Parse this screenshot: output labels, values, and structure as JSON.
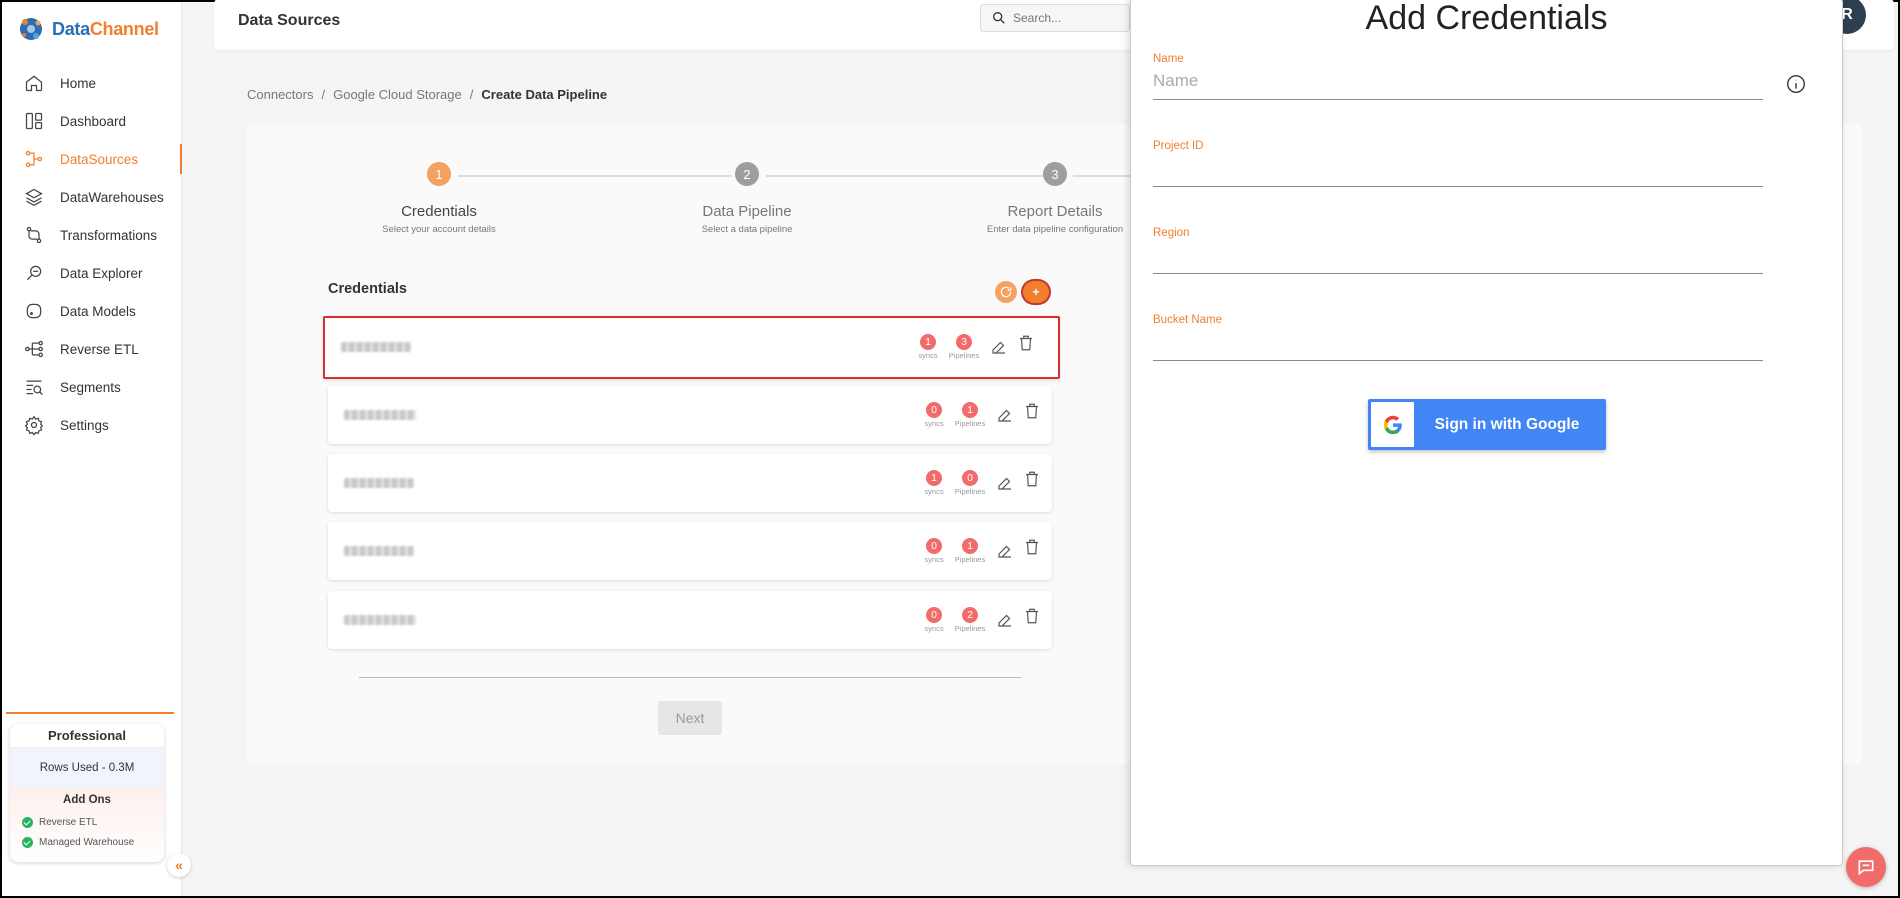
{
  "brand": {
    "name_part1": "Data",
    "name_part2": "Channel"
  },
  "sidebar": {
    "items": [
      {
        "label": "Home",
        "icon": "home-icon"
      },
      {
        "label": "Dashboard",
        "icon": "dashboard-icon"
      },
      {
        "label": "DataSources",
        "icon": "datasources-icon",
        "active": true
      },
      {
        "label": "DataWarehouses",
        "icon": "layers-icon"
      },
      {
        "label": "Transformations",
        "icon": "transform-icon"
      },
      {
        "label": "Data Explorer",
        "icon": "explorer-icon"
      },
      {
        "label": "Data Models",
        "icon": "models-icon"
      },
      {
        "label": "Reverse ETL",
        "icon": "reverse-etl-icon"
      },
      {
        "label": "Segments",
        "icon": "segments-icon"
      },
      {
        "label": "Settings",
        "icon": "settings-icon"
      }
    ],
    "plan": {
      "name": "Professional",
      "rows_used": "Rows Used - 0.3M",
      "addons_title": "Add Ons",
      "addons": [
        "Reverse ETL",
        "Managed Warehouse"
      ]
    },
    "collapse_glyph": "«"
  },
  "header": {
    "title": "Data Sources",
    "search_placeholder": "Search...",
    "avatar_initial": "R"
  },
  "breadcrumb": {
    "items": [
      "Connectors",
      "Google Cloud Storage"
    ],
    "separator": "/",
    "current": "Create Data Pipeline"
  },
  "stepper": {
    "steps": [
      {
        "number": "1",
        "title": "Credentials",
        "subtitle": "Select your account details",
        "active": true
      },
      {
        "number": "2",
        "title": "Data Pipeline",
        "subtitle": "Select a data pipeline"
      },
      {
        "number": "3",
        "title": "Report Details",
        "subtitle": "Enter data pipeline configuration"
      }
    ]
  },
  "credentials": {
    "heading": "Credentials",
    "add_label": "+",
    "rows": [
      {
        "syncs": "1",
        "pipelines": "3",
        "selected": true
      },
      {
        "syncs": "0",
        "pipelines": "1"
      },
      {
        "syncs": "1",
        "pipelines": "0"
      },
      {
        "syncs": "0",
        "pipelines": "1"
      },
      {
        "syncs": "0",
        "pipelines": "2"
      }
    ],
    "syncs_label": "syncs",
    "pipelines_label": "Pipelines",
    "next_label": "Next"
  },
  "drawer": {
    "title": "Add Credentials",
    "fields": [
      {
        "label": "Name",
        "placeholder": "Name",
        "value": ""
      },
      {
        "label": "Project ID",
        "placeholder": "",
        "value": ""
      },
      {
        "label": "Region",
        "placeholder": "",
        "value": ""
      },
      {
        "label": "Bucket Name",
        "placeholder": "",
        "value": ""
      }
    ],
    "google_button": "Sign in with Google"
  },
  "colors": {
    "accent": "#f07f2e",
    "badge": "#f26b6b",
    "google_blue": "#4285f4",
    "selected_border": "#d32f2f"
  }
}
